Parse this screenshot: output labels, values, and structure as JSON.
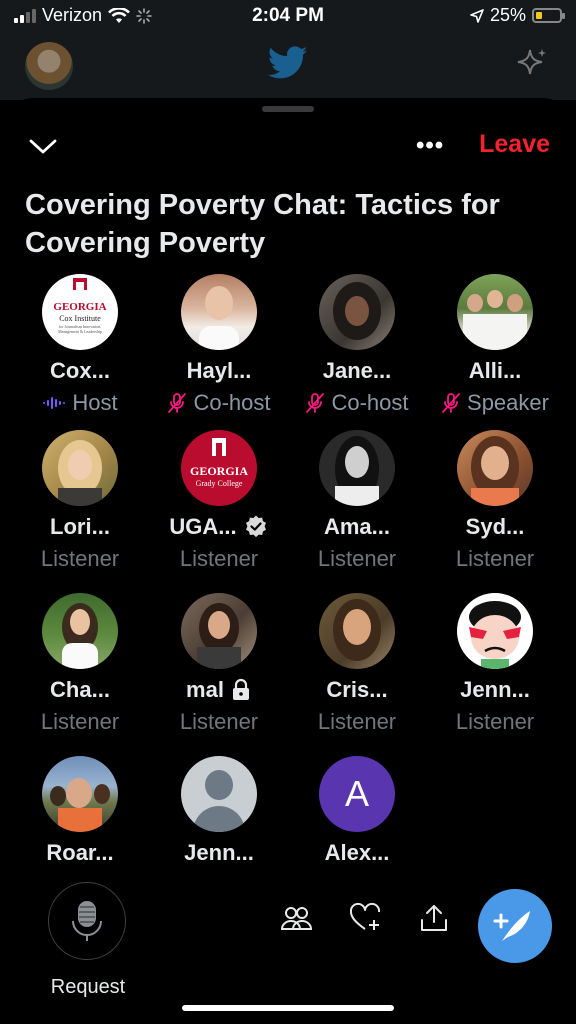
{
  "status": {
    "carrier": "Verizon",
    "time": "2:04 PM",
    "battery": "25%"
  },
  "icons": {
    "header_logo": "twitter-bird-icon",
    "spark": "sparkle-icon"
  },
  "space": {
    "title": "Covering Poverty Chat: Tactics for Covering Poverty",
    "more_label": "•••",
    "leave_label": "Leave"
  },
  "participants": [
    {
      "name": "Cox...",
      "role": "Host"
    },
    {
      "name": "Hayl...",
      "role": "Co-host"
    },
    {
      "name": "Jane...",
      "role": "Co-host"
    },
    {
      "name": "Alli...",
      "role": "Speaker"
    },
    {
      "name": "Lori...",
      "role": "Listener"
    },
    {
      "name": "UGA...",
      "role": "Listener"
    },
    {
      "name": "Ama...",
      "role": "Listener"
    },
    {
      "name": "Syd...",
      "role": "Listener"
    },
    {
      "name": "Cha...",
      "role": "Listener"
    },
    {
      "name": "mal",
      "role": "Listener"
    },
    {
      "name": "Cris...",
      "role": "Listener"
    },
    {
      "name": "Jenn...",
      "role": "Listener"
    },
    {
      "name": "Roar...",
      "role": ""
    },
    {
      "name": "Jenn...",
      "role": ""
    },
    {
      "name": "Alex...",
      "role": ""
    }
  ],
  "logos": {
    "cox": {
      "title": "GEORGIA",
      "sub": "Cox Institute",
      "small": "for Journalism Innovation, Management & Leadership"
    },
    "uga": {
      "title": "GEORGIA",
      "sub": "Grady College"
    }
  },
  "alex_initial": "A",
  "bottom": {
    "request_label": "Request"
  },
  "colors": {
    "accent": "#1d9bf0",
    "leave": "#f4212e",
    "muted_mic": "#f91880",
    "fab": "#4a99e9"
  }
}
